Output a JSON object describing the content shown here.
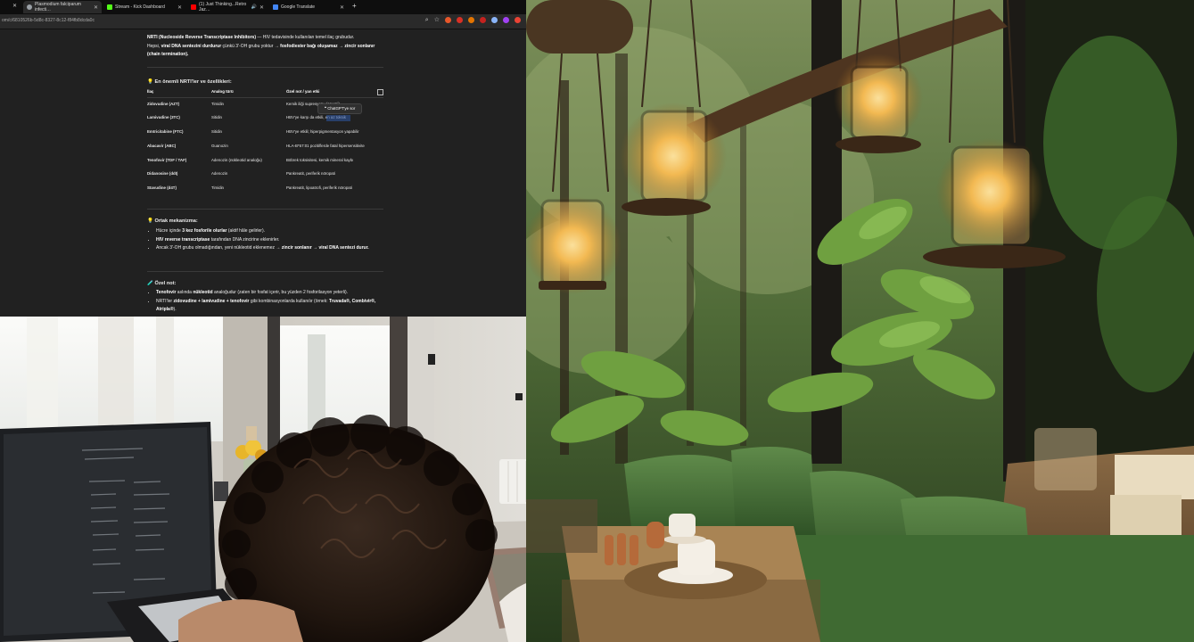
{
  "browser": {
    "tabs": [
      {
        "label": "Plasmodium falciparum infecti…",
        "active": true,
        "favicon_color": "#9aa0a6"
      },
      {
        "label": "Stream - Kick Dashboard",
        "active": false,
        "favicon_color": "#53fc18"
      },
      {
        "label": "(1) Just Thinking...Retro Jaz…",
        "active": false,
        "favicon_color": "#ff0000"
      },
      {
        "label": "Google Translate",
        "active": false,
        "favicon_color": "#4285f4"
      }
    ],
    "new_tab_label": "+",
    "url": "om/c/6810526b-5d8c-8327-8c12-f84fb8dcda0c"
  },
  "chat": {
    "intro_bold": "NRTI (Nucleoside Reverse Transcriptase Inhibitors)",
    "intro_rest": " — HIV tedavisinde kullanılan temel ilaç grubudur.",
    "intro_line2_a": "Hepsi, ",
    "intro_line2_bold": "viral DNA sentezini durdurur",
    "intro_line2_b": " çünkü 3'-OH grubu yoktur → ",
    "intro_line2_bold2": "fosfodiester bağı oluşamaz → zincir sonlanır (chain termination).",
    "section1_heading": "💡 En önemli NRTI'ler ve özellikleri:",
    "table_headers": [
      "İlaç",
      "Analog türü",
      "Özel not / yan etki"
    ],
    "table_rows": [
      [
        "Zidovudine (AZT)",
        "Timidin",
        "Kemik iliği supresyonu (anemi)"
      ],
      [
        "Lamivudine (3TC)",
        "Sitidin",
        "HBV'ye karşı da etkili, en az toksik"
      ],
      [
        "Emtricitabine (FTC)",
        "Sitidin",
        "HBV'ye etkili; hiperpigmentasyon yapabilir"
      ],
      [
        "Abacavir (ABC)",
        "Guanozin",
        "HLA-B*57:01 pozitiflerde fatal hipersensitivite"
      ],
      [
        "Tenofovir (TDF / TAF)",
        "Adenozin (nükleotid analoğu)",
        "Böbrek toksisitesi, kemik mineral kaybı"
      ],
      [
        "Didanosine (ddI)",
        "Adenozin",
        "Pankreatit, periferik nöropati"
      ],
      [
        "Stavudine (d4T)",
        "Timidin",
        "Pankreatit, lipoatrofi, periferik nöropati"
      ]
    ],
    "ask_popup": "❝ ChatGPT'ye sor",
    "section2_heading": "💡 Ortak mekanizma:",
    "section2_items": [
      [
        "Hücre içinde ",
        "3 kez fosforile olurlar",
        " (aktif hâle gelirler)."
      ],
      [
        "",
        "HIV reverse transcriptase",
        " tarafından DNA zincirine eklenirler."
      ],
      [
        "Ancak 3'-OH grubu olmadığından, yeni nükleotid eklenemez → ",
        "zincir sonlanır → viral DNA sentezi durur.",
        ""
      ]
    ],
    "section3_heading": "🧪 Özel not:",
    "section3_items": [
      [
        "",
        "Tenofovir",
        " aslında ",
        "nükleotid",
        " analoğudur (zaten bir fosfat içerir, bu yüzden 2 fosforilasyon yeterli)."
      ],
      [
        "NRTI'ler ",
        "zidovudine + lamivudine + tenofovir",
        " gibi kombinasyonlarda kullanılır (örnek: ",
        "Truvada®, Combivir®, Atripla®",
        ")."
      ]
    ]
  },
  "colors": {
    "page_bg": "#212121",
    "tabbar_bg": "#0e0e0e",
    "highlight": "#2f5aa8"
  }
}
